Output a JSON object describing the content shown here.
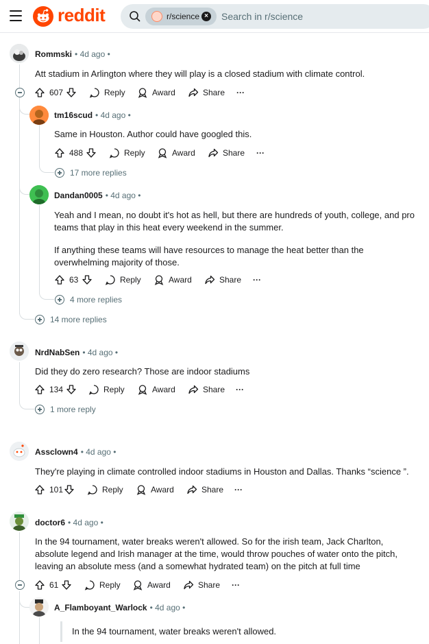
{
  "header": {
    "brand": "reddit",
    "subreddit_chip": "r/science",
    "search_placeholder": "Search in r/science"
  },
  "comments": [
    {
      "user": "Rommski",
      "age": "• 4d ago •",
      "text": "Att stadium in Arlington where they will play is a closed stadium with climate control.",
      "votes": "607",
      "reply": "Reply",
      "award": "Award",
      "share": "Share",
      "more": "···",
      "replies": [
        {
          "user": "tm16scud",
          "age": "• 4d ago •",
          "text": "Same in Houston. Author could have googled this.",
          "votes": "488",
          "reply": "Reply",
          "award": "Award",
          "share": "Share",
          "more": "···",
          "more_replies": "17 more replies"
        },
        {
          "user": "Dandan0005",
          "age": "• 4d ago •",
          "text1": "Yeah and I mean, no doubt it's hot as hell, but there are hundreds of youth, college, and pro teams that play in this heat every weekend in the summer.",
          "text2": "If anything these teams will have resources to manage the heat better than the overwhelming majority of those.",
          "votes": "63",
          "reply": "Reply",
          "award": "Award",
          "share": "Share",
          "more": "···",
          "more_replies": "4 more replies"
        }
      ],
      "more_replies": "14 more replies"
    },
    {
      "user": "NrdNabSen",
      "age": "• 4d ago •",
      "text": "Did they do zero research? Those are indoor stadiums",
      "votes": "134",
      "reply": "Reply",
      "award": "Award",
      "share": "Share",
      "more": "···",
      "more_replies": "1 more reply"
    },
    {
      "user": "Assclown4",
      "age": "• 4d ago •",
      "text": "They're playing in climate controlled indoor stadiums in Houston and Dallas. Thanks “science ”.",
      "votes": "101",
      "reply": "Reply",
      "award": "Award",
      "share": "Share",
      "more": "···"
    },
    {
      "user": "doctor6",
      "age": "• 4d ago •",
      "text": "In the 94 tournament, water breaks weren't allowed. So for the irish team, Jack Charlton, absolute legend and Irish manager at the time, would throw pouches of water onto the pitch, leaving an absolute mess (and a somewhat hydrated team) on the pitch at full time",
      "votes": "61",
      "reply": "Reply",
      "award": "Award",
      "share": "Share",
      "more": "···",
      "replies": [
        {
          "user": "A_Flamboyant_Warlock",
          "age": "• 4d ago •",
          "quote": "In the 94 tournament, water breaks weren't allowed."
        }
      ]
    }
  ],
  "colors": {
    "brand": "#ff4500",
    "meta": "#576f76",
    "thread": "#d8dde0"
  }
}
